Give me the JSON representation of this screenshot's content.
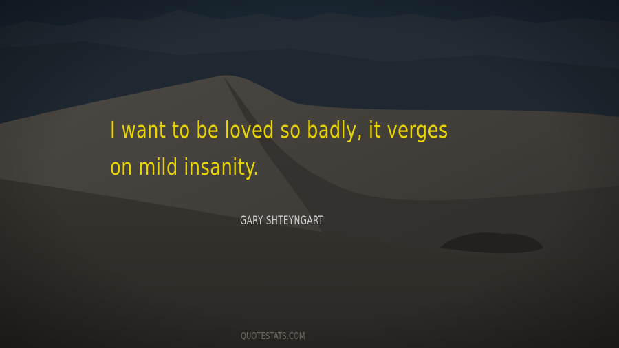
{
  "quote": {
    "line1": "I want to be loved so badly, it verges",
    "line2": "on mild insanity."
  },
  "author": "GARY SHTEYNGART",
  "site": "QUOTESTATS.COM",
  "colors": {
    "quote_text": "#e8d400",
    "author_text": "#cfcfcf",
    "site_text": "#6f6c66",
    "sky": "#1b2733",
    "mountains": "#232c34",
    "dune_light": "#4e4b47",
    "dune_shadow": "#2b2927"
  }
}
